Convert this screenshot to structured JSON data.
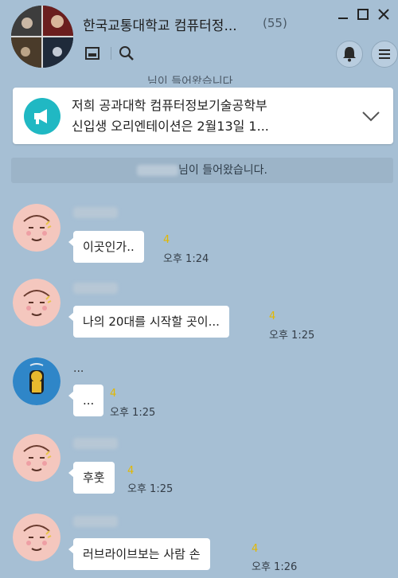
{
  "header": {
    "title": "한국교통대학교 컴퓨터정...",
    "member_count": "(55)",
    "window_buttons": [
      "minimize-icon",
      "maximize-icon",
      "close-icon"
    ],
    "tools": [
      "image-icon",
      "search-icon"
    ],
    "right_buttons": [
      "bell-icon",
      "menu-icon"
    ]
  },
  "partial_line": "님이 들어왔습니다.",
  "notice": {
    "icon": "megaphone-icon",
    "line1": "저희 공과대학 컴퓨터정보기술공학부",
    "line2": "신입생 오리엔테이션은 2월13일 1..."
  },
  "system_message": {
    "suffix": "님이 들어왔습니다."
  },
  "messages": [
    {
      "avatar": "peach-avatar",
      "text": "이곳인가..",
      "unread": "4",
      "time": "오후 1:24"
    },
    {
      "avatar": "peach-avatar",
      "text": "나의 20대를 시작할 곳이...",
      "unread": "4",
      "time": "오후 1:25"
    },
    {
      "avatar": "character-avatar",
      "sender": "...",
      "text": "...",
      "unread": "4",
      "time": "오후 1:25"
    },
    {
      "avatar": "peach-avatar",
      "text": "후훗",
      "unread": "4",
      "time": "오후 1:25"
    },
    {
      "avatar": "peach-avatar",
      "text": "러브라이브보는 사람 손",
      "unread": "4",
      "time": "오후 1:26"
    }
  ],
  "colors": {
    "background": "#a6bfd4",
    "notice_accent": "#20b8c3",
    "unread": "#e3b800",
    "bubble": "#ffffff"
  }
}
